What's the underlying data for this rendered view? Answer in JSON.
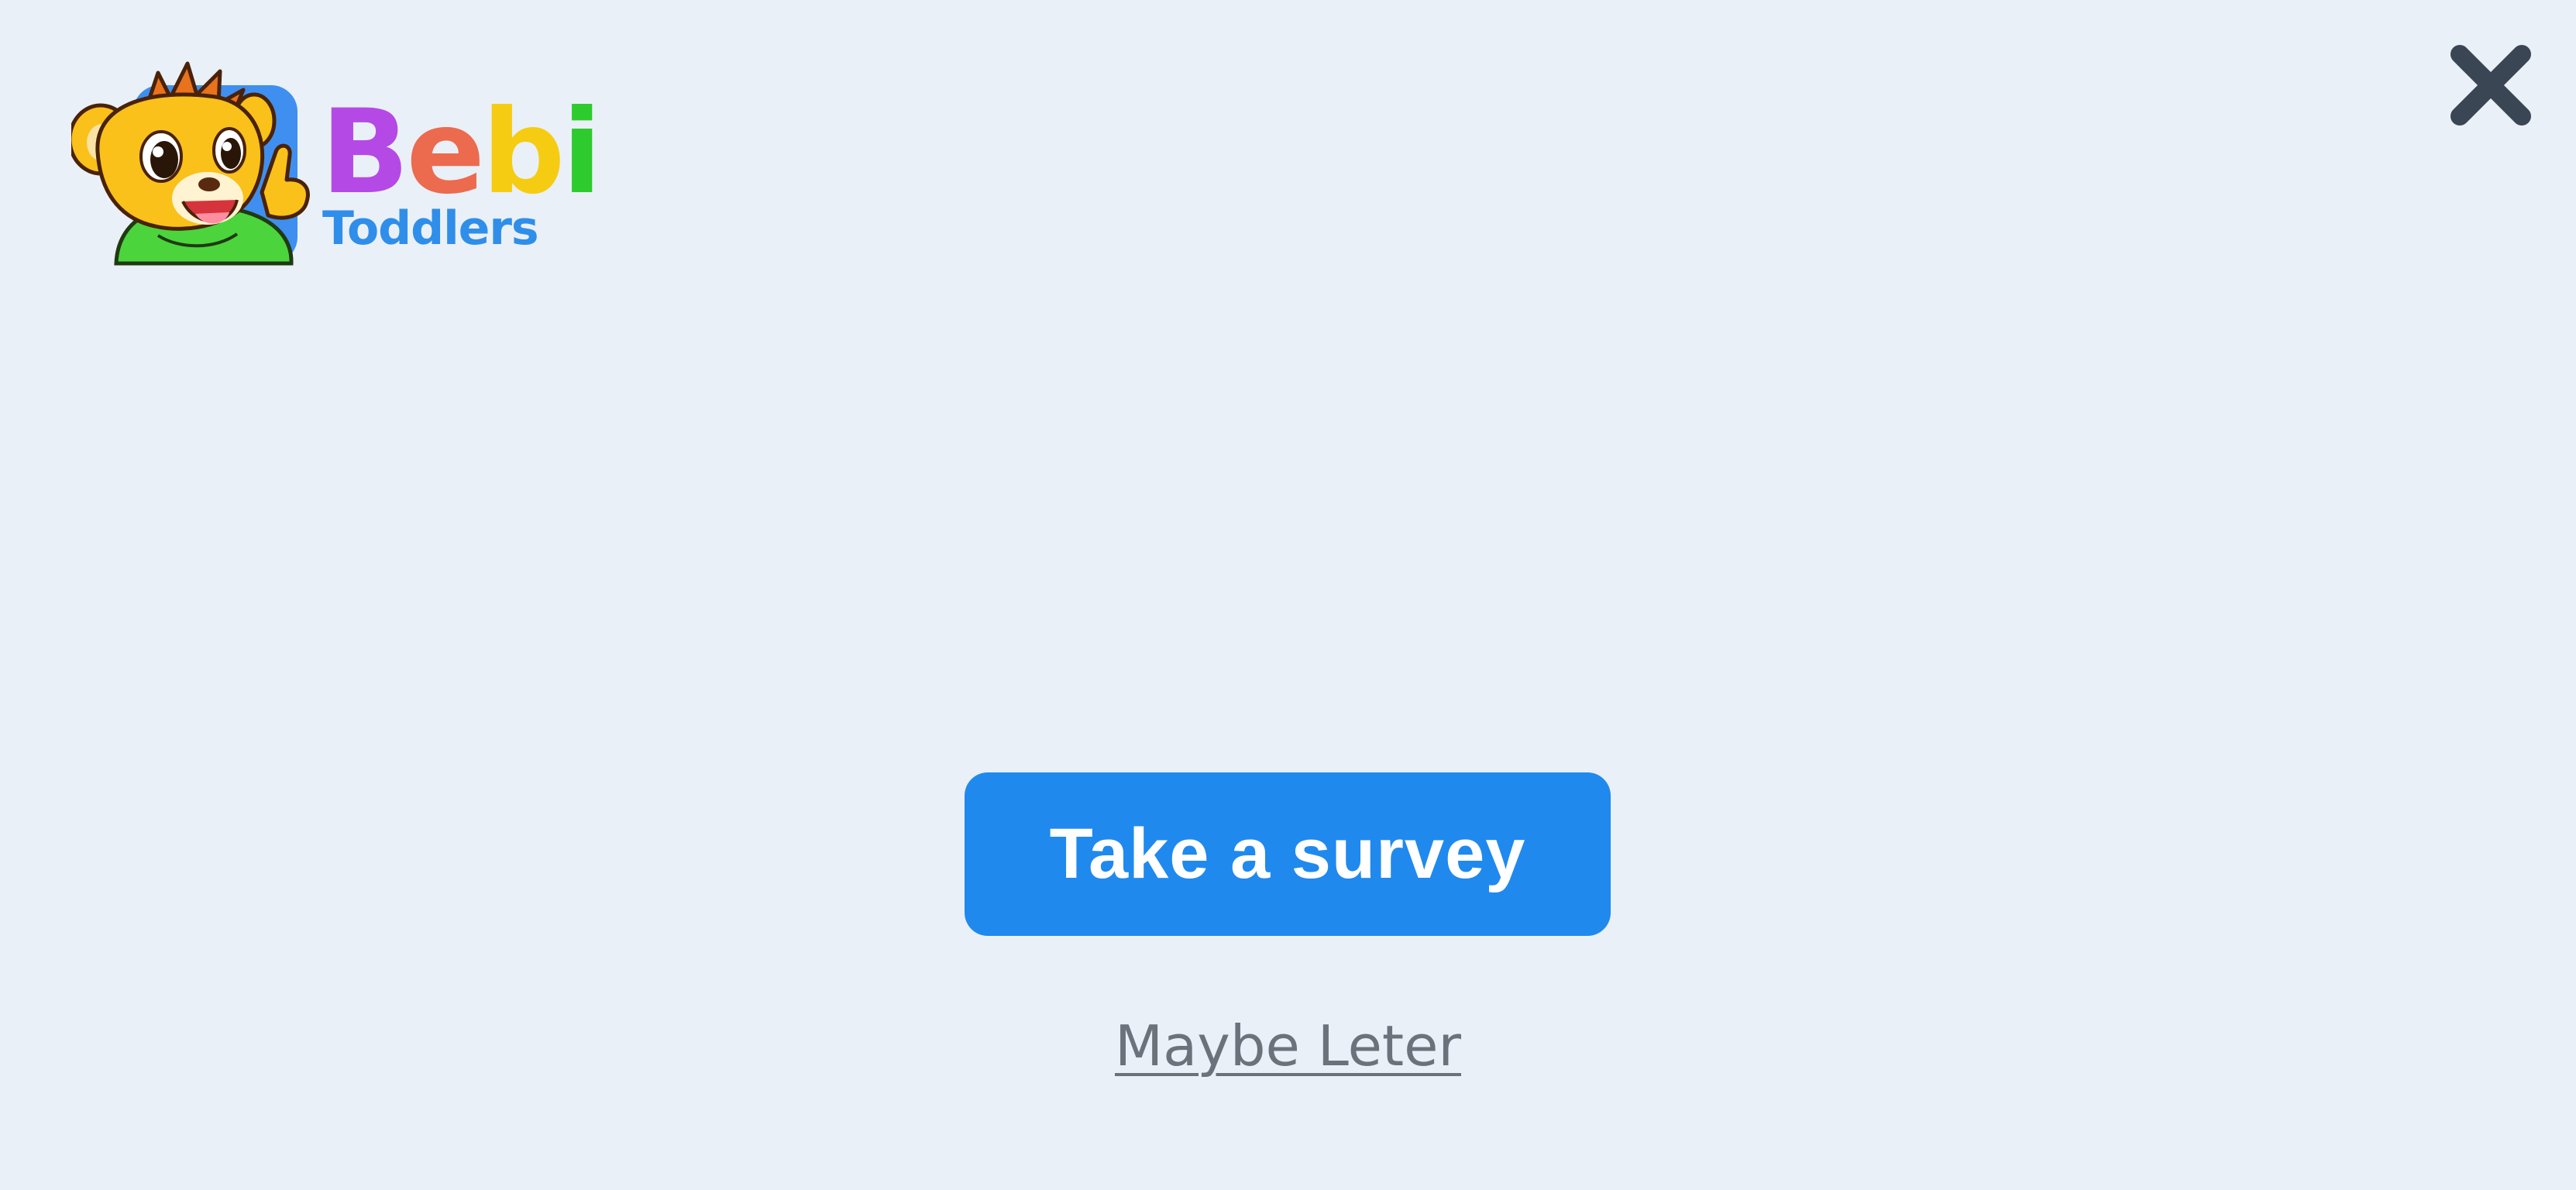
{
  "app": {
    "brand": {
      "letters": [
        {
          "char": "B",
          "color": "#b549e6"
        },
        {
          "char": "e",
          "color": "#ec6a4e"
        },
        {
          "char": "b",
          "color": "#f6cc12"
        },
        {
          "char": "i",
          "color": "#2ecb2e"
        }
      ],
      "subtitle": "Toddlers",
      "subtitle_color": "#2f8ee9",
      "mascot_icon": "lion-cub-mascot-icon"
    }
  },
  "dialog": {
    "close_icon": "close-icon",
    "close_color": "#3a4653",
    "primary_button": {
      "label": "Take a survey",
      "background": "#2089ee"
    },
    "secondary_link": {
      "label": "Maybe Leter",
      "color": "#6b727b"
    }
  },
  "colors": {
    "background": "#eaf0f7"
  }
}
